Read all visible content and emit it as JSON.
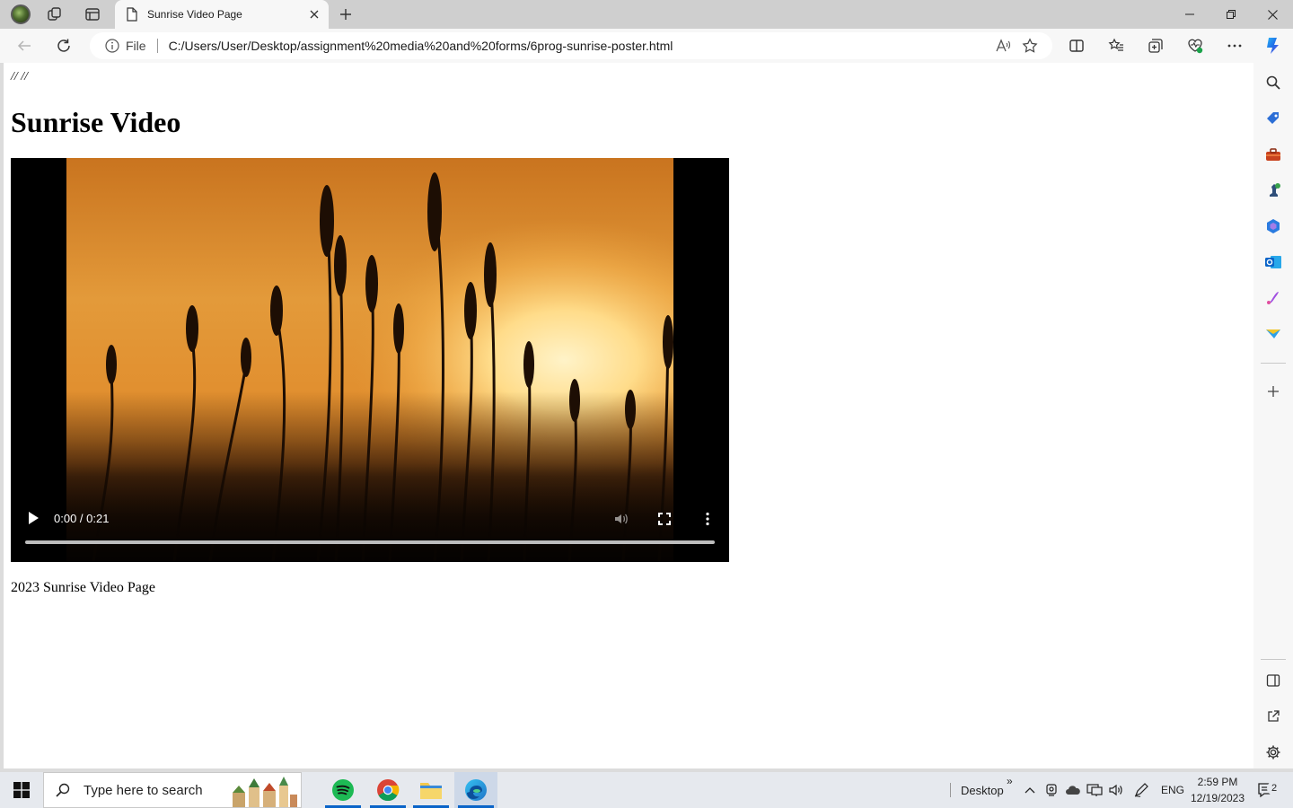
{
  "browser": {
    "tab_title": "Sunrise Video Page",
    "omnibox": {
      "scheme_label": "File",
      "url": "C:/Users/User/Desktop/assignment%20media%20and%20forms/6prog-sunrise-poster.html"
    }
  },
  "page": {
    "comment_text": "// //",
    "heading": "Sunrise Video",
    "video": {
      "time": "0:00 / 0:21",
      "progress": 0
    },
    "footer": "2023 Sunrise Video Page"
  },
  "taskbar": {
    "search_placeholder": "Type here to search",
    "desktop_label": "Desktop",
    "overflow_label": "»",
    "language": "ENG",
    "time": "2:59 PM",
    "date": "12/19/2023",
    "notification_count": "2"
  },
  "icons": {
    "sidebar": [
      "search-icon",
      "tag-icon",
      "toolbox-icon",
      "chess-icon",
      "circle-app-icon",
      "outlook-icon",
      "designer-icon",
      "send-icon",
      "plus-icon",
      "panel-icon",
      "external-icon",
      "gear-icon"
    ],
    "toolbar": [
      "back-icon",
      "refresh-icon",
      "info-icon",
      "read-aloud-icon",
      "favorite-icon",
      "split-screen-icon",
      "favorites-icon",
      "collections-icon",
      "performance-icon",
      "more-icon",
      "copilot-icon"
    ]
  },
  "colors": {
    "accent": "#0a64c8",
    "page_bg": "#ffffff",
    "chrome_bg": "#f7f7f7",
    "titlebar_bg": "#cfcfcf",
    "spotify": "#1db954"
  }
}
